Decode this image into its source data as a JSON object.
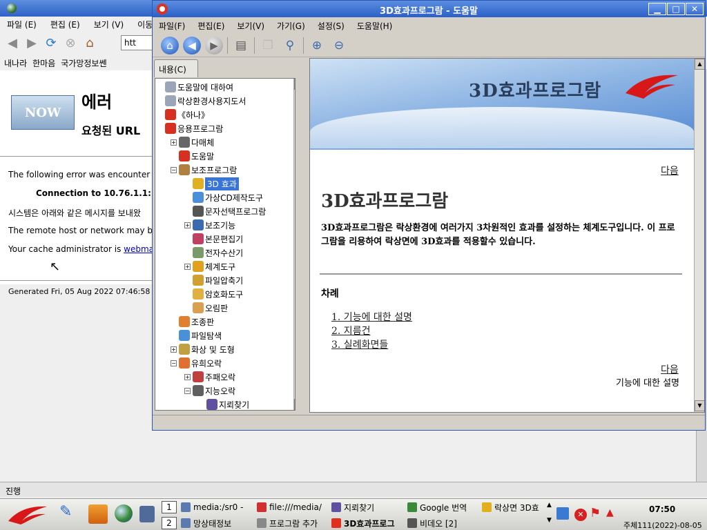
{
  "bg_browser": {
    "menu": [
      "파일 (E)",
      "편집 (E)",
      "보기 (V)",
      "이동"
    ],
    "url": "htt",
    "bookmarks": [
      "내나라",
      "한마음",
      "국가망정보쎈"
    ],
    "error_title": "에러",
    "error_subtitle": "요청된 URL",
    "now_label": "NOW",
    "lines": [
      "The following error was encounter",
      "Connection to 10.76.1.1:",
      "시스템은 아래와 같은 메시지를 보내왔",
      "The remote host or network may b",
      "Your cache administrator is "
    ],
    "admin_link": "webma",
    "generated": "Generated Fri, 05 Aug 2022 07:46:58 G",
    "status": "진행"
  },
  "help": {
    "title": "3D효과프로그람 - 도움말",
    "menu": [
      "파일(F)",
      "편집(E)",
      "보기(V)",
      "가기(G)",
      "설정(S)",
      "도움말(H)"
    ],
    "tab": "내용(C)",
    "tree": [
      {
        "label": "도움말에 대하여",
        "indent": 0,
        "exp": "",
        "color": "#9aa6b8"
      },
      {
        "label": "락상환경사용지도서",
        "indent": 0,
        "exp": "",
        "color": "#9aa6b8"
      },
      {
        "label": "《하나》",
        "indent": 0,
        "exp": "",
        "color": "#d83020"
      },
      {
        "label": "응용프로그람",
        "indent": 0,
        "exp": "",
        "color": "#d83020"
      },
      {
        "label": "다매체",
        "indent": 1,
        "exp": "+",
        "color": "#666"
      },
      {
        "label": "도움말",
        "indent": 1,
        "exp": "",
        "color": "#d83020"
      },
      {
        "label": "보조프로그람",
        "indent": 1,
        "exp": "−",
        "color": "#b08040"
      },
      {
        "label": "3D 효과",
        "indent": 2,
        "exp": "",
        "color": "#e0b020",
        "selected": true
      },
      {
        "label": "가상CD제작도구",
        "indent": 2,
        "exp": "",
        "color": "#4a90d8"
      },
      {
        "label": "문자선택프로그람",
        "indent": 2,
        "exp": "",
        "color": "#555"
      },
      {
        "label": "보조기능",
        "indent": 2,
        "exp": "+",
        "color": "#3a6ab0"
      },
      {
        "label": "본문편집기",
        "indent": 2,
        "exp": "",
        "color": "#c04060"
      },
      {
        "label": "전자수산기",
        "indent": 2,
        "exp": "",
        "color": "#7a9a6a"
      },
      {
        "label": "체계도구",
        "indent": 2,
        "exp": "+",
        "color": "#e0a020"
      },
      {
        "label": "파일압축기",
        "indent": 2,
        "exp": "",
        "color": "#d0a030"
      },
      {
        "label": "암호화도구",
        "indent": 2,
        "exp": "",
        "color": "#e0b040"
      },
      {
        "label": "오림판",
        "indent": 2,
        "exp": "",
        "color": "#d8a050"
      },
      {
        "label": "조종판",
        "indent": 1,
        "exp": "",
        "color": "#e08030"
      },
      {
        "label": "파일탐색",
        "indent": 1,
        "exp": "",
        "color": "#4a90d8"
      },
      {
        "label": "화상 및 도형",
        "indent": 1,
        "exp": "+",
        "color": "#c0a040"
      },
      {
        "label": "유희오락",
        "indent": 1,
        "exp": "−",
        "color": "#e07030"
      },
      {
        "label": "주패오락",
        "indent": 2,
        "exp": "+",
        "color": "#c04040"
      },
      {
        "label": "지능오락",
        "indent": 2,
        "exp": "−",
        "color": "#606060"
      },
      {
        "label": "지뢰찾기",
        "indent": 3,
        "exp": "",
        "color": "#6050a0"
      }
    ],
    "banner_title": "3D효과프로그람",
    "next": "다음",
    "heading": "3D효과프로그람",
    "paragraph": "3D효과프로그람은 락상환경에 여러가지 3차원적인 효과를 설정하는 체계도구입니다. 이 프로그람을 리용하여 락상면에 3D효과를 적용할수 있습니다.",
    "toc_heading": "차례",
    "toc": [
      "1. 기능에 대한 설명",
      "2. 지름건",
      "3. 실례화면들"
    ],
    "next_sub": "기능에 대한 설명"
  },
  "taskbar": {
    "row1": [
      {
        "label": "media:/sr0 -",
        "color": "#5a7ab0"
      },
      {
        "label": "file:///media/",
        "color": "#d03030"
      },
      {
        "label": "지뢰찾기",
        "color": "#6050a0"
      },
      {
        "label": "Google 번역",
        "color": "#3a8a3a"
      },
      {
        "label": "락상면 3D효",
        "color": "#e0b020"
      }
    ],
    "row2": [
      {
        "label": "망상태정보",
        "color": "#5a7ab0"
      },
      {
        "label": "프로그람 추가",
        "color": "#888"
      },
      {
        "label": "3D효과프로그",
        "color": "#e03020",
        "active": true
      },
      {
        "label": "비데오 [2]",
        "color": "#555"
      }
    ],
    "ws1": "1",
    "ws2": "2",
    "time": "07:50",
    "date": "주체111(2022)-08-05"
  }
}
